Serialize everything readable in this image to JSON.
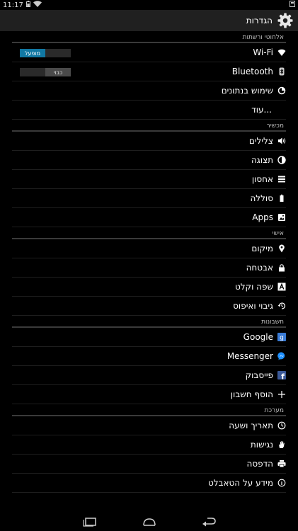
{
  "status_bar": {
    "time": "11:17"
  },
  "action_bar": {
    "title": "הגדרות"
  },
  "sections": [
    {
      "header": "אלחוטי ורשתות",
      "items": [
        {
          "label": "Wi-Fi",
          "icon": "wifi-icon",
          "toggle": "on",
          "toggle_text": "מופעל"
        },
        {
          "label": "Bluetooth",
          "icon": "bluetooth-icon",
          "toggle": "off",
          "toggle_text": "כבוי"
        },
        {
          "label": "שימוש בנתונים",
          "icon": "data-usage-icon"
        },
        {
          "label": "עוד..."
        }
      ]
    },
    {
      "header": "מכשיר",
      "items": [
        {
          "label": "צלילים",
          "icon": "sound-icon"
        },
        {
          "label": "תצוגה",
          "icon": "display-icon"
        },
        {
          "label": "אחסון",
          "icon": "storage-icon"
        },
        {
          "label": "סוללה",
          "icon": "battery-icon"
        },
        {
          "label": "Apps",
          "icon": "apps-icon"
        }
      ]
    },
    {
      "header": "אישי",
      "items": [
        {
          "label": "מיקום",
          "icon": "location-icon"
        },
        {
          "label": "אבטחה",
          "icon": "security-lock-icon"
        },
        {
          "label": "שפה וקלט",
          "icon": "language-icon"
        },
        {
          "label": "גיבוי ואיפוס",
          "icon": "backup-icon"
        }
      ]
    },
    {
      "header": "חשבונות",
      "items": [
        {
          "label": "Google",
          "icon": "google-icon"
        },
        {
          "label": "Messenger",
          "icon": "messenger-icon"
        },
        {
          "label": "פייסבוק",
          "icon": "facebook-icon"
        },
        {
          "label": "הוסף חשבון",
          "icon": "plus-icon"
        }
      ]
    },
    {
      "header": "מערכת",
      "items": [
        {
          "label": "תאריך ושעה",
          "icon": "clock-icon"
        },
        {
          "label": "נגישות",
          "icon": "accessibility-hand-icon"
        },
        {
          "label": "הדפסה",
          "icon": "print-icon"
        },
        {
          "label": "מידע על הטאבלט",
          "icon": "info-icon"
        }
      ]
    }
  ],
  "nav_bar": {
    "buttons": [
      "recent-apps-icon",
      "home-icon",
      "back-icon"
    ]
  },
  "colors": {
    "accent": "#1178a3",
    "background": "#000000",
    "action_bar": "#202020"
  }
}
